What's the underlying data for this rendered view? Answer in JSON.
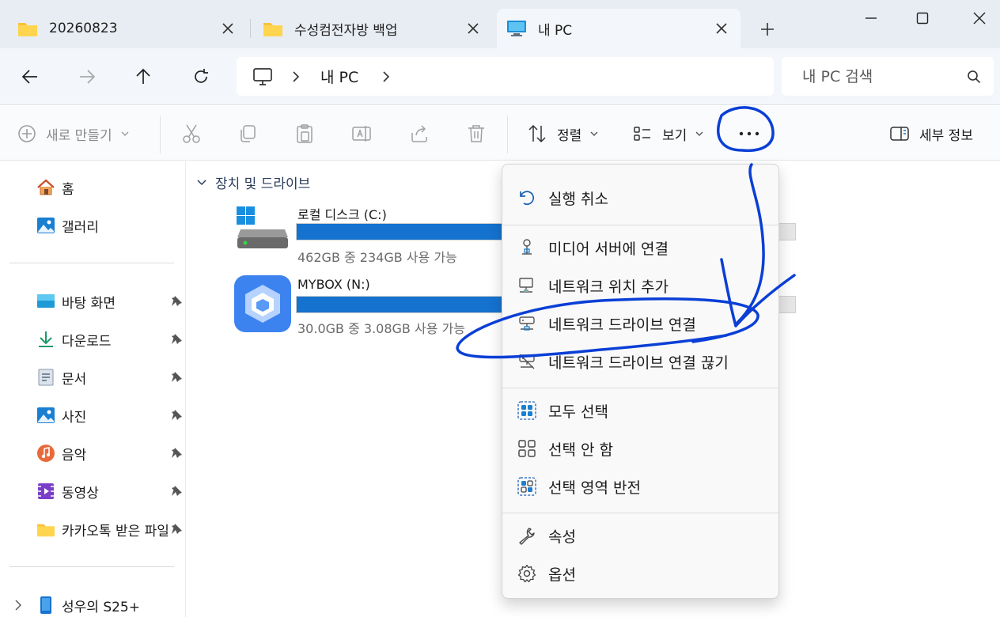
{
  "tabs": [
    {
      "label": "20260823",
      "icon": "folder-icon"
    },
    {
      "label": "수성컴전자방 백업",
      "icon": "folder-icon"
    },
    {
      "label": "내 PC",
      "icon": "this-pc-icon"
    }
  ],
  "nav": {
    "address_crumb": "내 PC",
    "search_placeholder": "내 PC 검색"
  },
  "command_bar": {
    "new_label": "새로 만들기",
    "sort_label": "정렬",
    "view_label": "보기",
    "more_label": "...",
    "details_label": "세부 정보"
  },
  "sidebar": {
    "top": [
      {
        "label": "홈",
        "icon": "home-icon"
      },
      {
        "label": "갤러리",
        "icon": "gallery-icon"
      }
    ],
    "pinned": [
      {
        "label": "바탕 화면",
        "icon": "desktop-icon"
      },
      {
        "label": "다운로드",
        "icon": "download-icon"
      },
      {
        "label": "문서",
        "icon": "document-icon"
      },
      {
        "label": "사진",
        "icon": "picture-icon"
      },
      {
        "label": "음악",
        "icon": "music-icon"
      },
      {
        "label": "동영상",
        "icon": "video-icon"
      },
      {
        "label": "카카오톡 받은 파일",
        "icon": "folder-icon"
      }
    ],
    "devices": [
      {
        "label": "성우의 S25+",
        "icon": "phone-icon"
      }
    ]
  },
  "content": {
    "group_label": "장치 및 드라이브",
    "drives": [
      {
        "name": "로컬 디스크 (C:)",
        "size_text": "462GB 중 234GB 사용 가능",
        "used_fraction": 0.49,
        "icon": "windows-drive-icon"
      },
      {
        "name": "MYBOX (N:)",
        "size_text": "30.0GB 중 3.08GB 사용 가능",
        "used_fraction": 0.9,
        "icon": "mybox-cube-icon"
      }
    ]
  },
  "menu": {
    "items": [
      {
        "label": "실행 취소",
        "icon": "undo-icon"
      },
      {
        "label": "미디어 서버에 연결",
        "icon": "media-server-icon"
      },
      {
        "label": "네트워크 위치 추가",
        "icon": "network-location-icon"
      },
      {
        "label": "네트워크 드라이브 연결",
        "icon": "map-network-drive-icon"
      },
      {
        "label": "네트워크 드라이브 연결 끊기",
        "icon": "disconnect-network-drive-icon"
      },
      {
        "label": "모두 선택",
        "icon": "select-all-icon"
      },
      {
        "label": "선택 안 함",
        "icon": "select-none-icon"
      },
      {
        "label": "선택 영역 반전",
        "icon": "invert-selection-icon"
      },
      {
        "label": "속성",
        "icon": "wrench-icon"
      },
      {
        "label": "옵션",
        "icon": "gear-icon"
      }
    ]
  },
  "colors": {
    "accent": "#1572cf",
    "annotation_ink": "#0a3fd6",
    "titlebar_bg": "#e8edf3"
  }
}
